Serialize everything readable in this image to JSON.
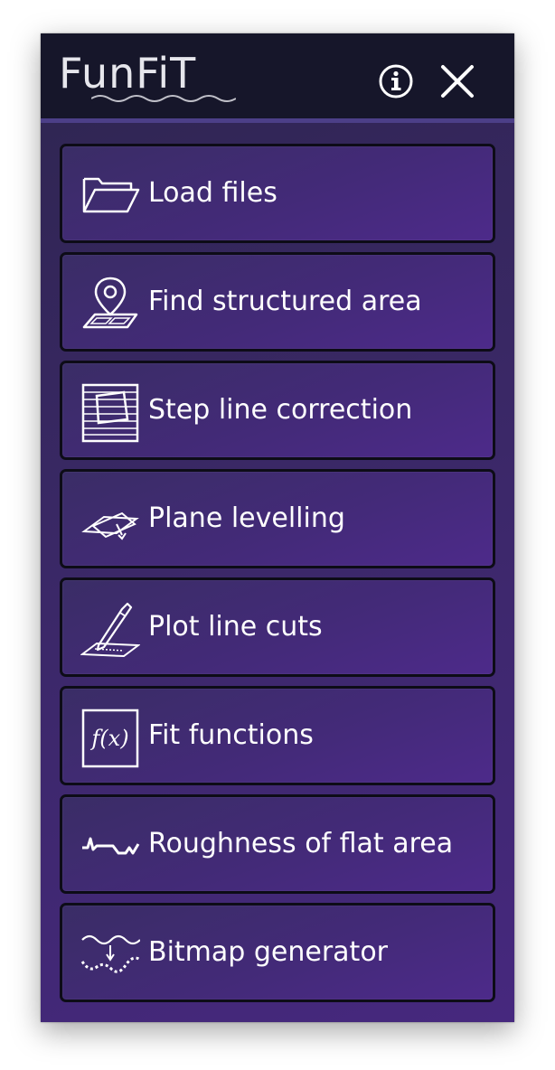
{
  "app": {
    "logo_text": "FunFiT"
  },
  "titlebar": {
    "info_icon": "info-icon",
    "close_icon": "close-icon"
  },
  "menu": {
    "items": [
      {
        "label": "Load files",
        "icon": "folder-icon"
      },
      {
        "label": "Find structured area",
        "icon": "map-pin-icon"
      },
      {
        "label": "Step line correction",
        "icon": "step-line-icon"
      },
      {
        "label": "Plane levelling",
        "icon": "plane-icon"
      },
      {
        "label": "Plot line cuts",
        "icon": "pen-cut-icon"
      },
      {
        "label": "Fit functions",
        "icon": "function-icon"
      },
      {
        "label": "Roughness of flat area",
        "icon": "roughness-wave-icon"
      },
      {
        "label": "Bitmap generator",
        "icon": "bitmap-icon"
      }
    ]
  },
  "colors": {
    "titlebar": "#16162a",
    "accent": "#4c3f88",
    "panel": "#3a2866",
    "button_border": "#0d0c17",
    "text": "#ffffff"
  }
}
